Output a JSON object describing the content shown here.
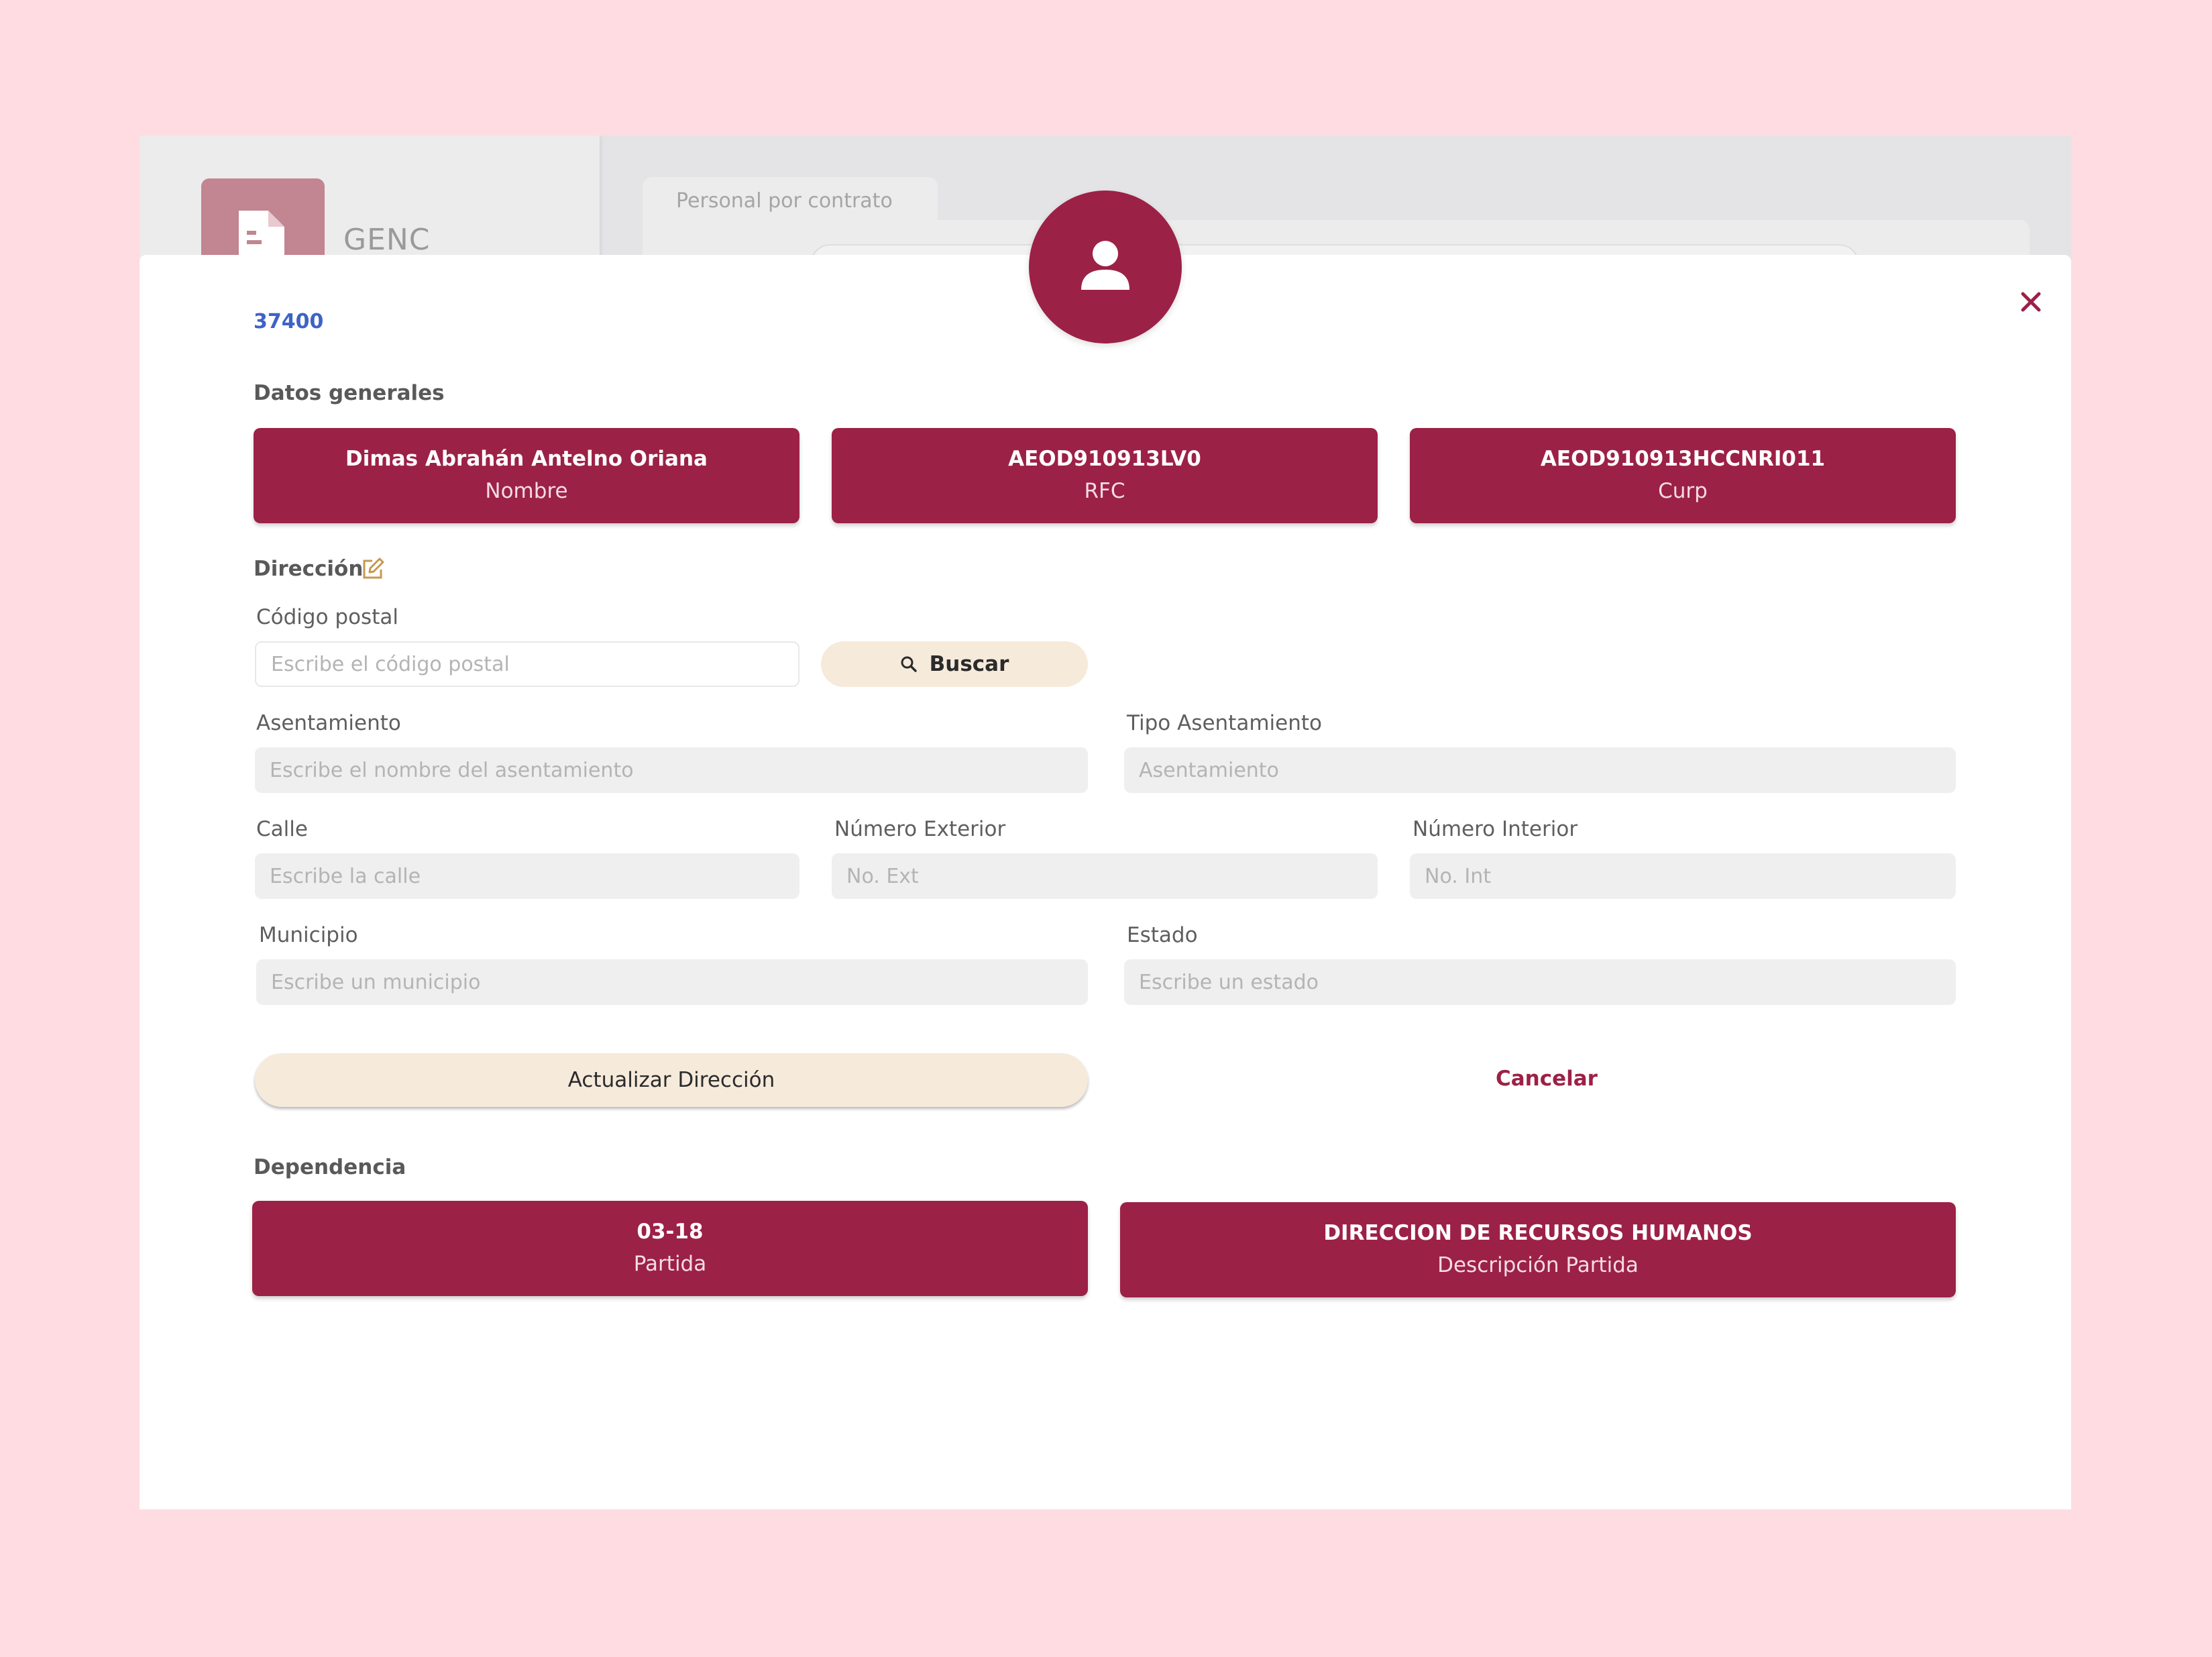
{
  "background_app": {
    "app_name": "GENC",
    "tab_label": "Personal por contrato"
  },
  "modal": {
    "employee_id": "37400",
    "general_section_title": "Datos generales",
    "general_cards": [
      {
        "value": "Dimas Abrahán Antelno Oriana",
        "label": "Nombre"
      },
      {
        "value": "AEOD910913LV0",
        "label": "RFC"
      },
      {
        "value": "AEOD910913HCCNRI011",
        "label": "Curp"
      }
    ],
    "address_section_title": "Dirección",
    "address_form": {
      "postal_code_label": "Código postal",
      "postal_code_placeholder": "Escribe el código postal",
      "search_button_label": "Buscar",
      "settlement_label": "Asentamiento",
      "settlement_placeholder": "Escribe el nombre del asentamiento",
      "settlement_type_label": "Tipo Asentamiento",
      "settlement_type_placeholder": "Asentamiento",
      "street_label": "Calle",
      "street_placeholder": "Escribe la calle",
      "ext_number_label": "Número Exterior",
      "ext_number_placeholder": "No. Ext",
      "int_number_label": "Número Interior",
      "int_number_placeholder": "No. Int",
      "municipality_label": "Municipio",
      "municipality_placeholder": "Escribe un municipio",
      "state_label": "Estado",
      "state_placeholder": "Escribe un estado",
      "update_button_label": "Actualizar Dirección",
      "cancel_label": "Cancelar"
    },
    "dependency_section_title": "Dependencia",
    "dependency_cards": [
      {
        "value": "03-18",
        "label": "Partida"
      },
      {
        "value": "DIRECCION DE RECURSOS HUMANOS",
        "label": "Descripción Partida"
      }
    ]
  },
  "colors": {
    "accent": "#9c2146",
    "link": "#3e63c6",
    "button_cream": "#f6eadb",
    "page_background": "#fedce2"
  },
  "icons": [
    "document-icon",
    "user-icon",
    "close-icon",
    "edit-icon",
    "search-icon"
  ]
}
